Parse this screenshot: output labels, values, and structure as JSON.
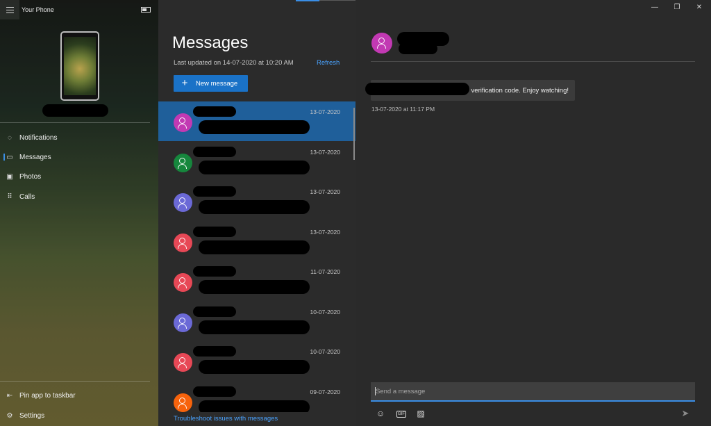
{
  "app": {
    "title": "Your Phone"
  },
  "sidebar": {
    "items": [
      {
        "label": "Notifications",
        "icon": "bell-icon",
        "glyph": "🔔"
      },
      {
        "label": "Messages",
        "icon": "message-icon",
        "glyph": "💬"
      },
      {
        "label": "Photos",
        "icon": "photo-icon",
        "glyph": "🖼"
      },
      {
        "label": "Calls",
        "icon": "dialpad-icon",
        "glyph": "⠿"
      }
    ],
    "pin_label": "Pin app to taskbar",
    "settings_label": "Settings"
  },
  "messages": {
    "title": "Messages",
    "updated": "Last updated on 14-07-2020 at 10:20 AM",
    "refresh_label": "Refresh",
    "new_message_label": "New message",
    "troubleshoot_label": "Troubleshoot issues with messages",
    "conversations": [
      {
        "date": "13-07-2020",
        "color": "#c239b3",
        "selected": true
      },
      {
        "date": "13-07-2020",
        "color": "#16873d",
        "selected": false
      },
      {
        "date": "13-07-2020",
        "color": "#6b69d6",
        "selected": false
      },
      {
        "date": "13-07-2020",
        "color": "#e74856",
        "selected": false
      },
      {
        "date": "11-07-2020",
        "color": "#e74856",
        "selected": false
      },
      {
        "date": "10-07-2020",
        "color": "#6b69d6",
        "selected": false
      },
      {
        "date": "10-07-2020",
        "color": "#e74856",
        "selected": false
      },
      {
        "date": "09-07-2020",
        "color": "#f7630c",
        "selected": false
      }
    ]
  },
  "thread": {
    "avatar_color": "#c239b3",
    "message_text": "verification code. Enjoy watching!",
    "message_time": "13-07-2020 at 11:17 PM",
    "input_placeholder": "Send a message"
  },
  "window": {
    "minimize": "—",
    "maximize": "❐",
    "close": "✕"
  }
}
